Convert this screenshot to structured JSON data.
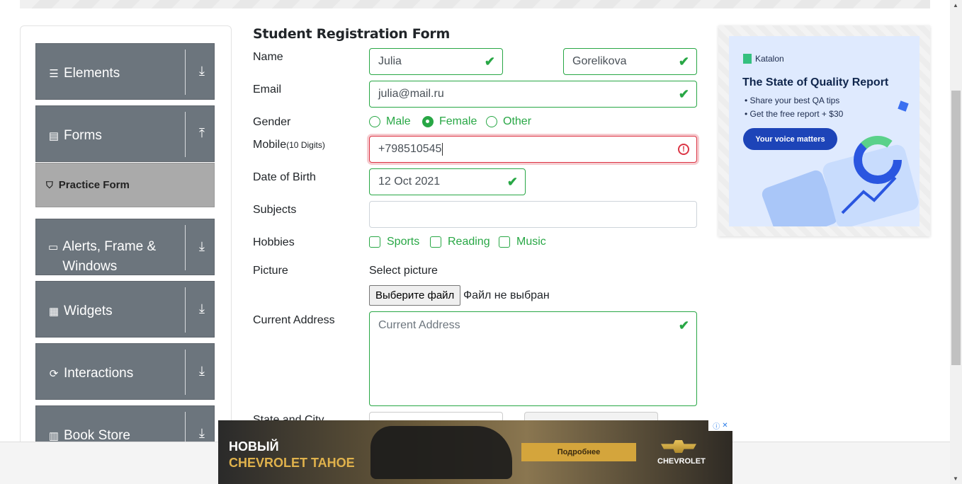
{
  "sidebar": {
    "groups": [
      {
        "label": "Elements",
        "icon": "hamburger-icon",
        "arrow": "⤓"
      },
      {
        "label": "Forms",
        "icon": "document-icon",
        "arrow": "⤒"
      },
      {
        "label": "Alerts, Frame & Windows",
        "icon": "window-icon",
        "arrow": "⤓"
      },
      {
        "label": "Widgets",
        "icon": "widgets-icon",
        "arrow": "⤓"
      },
      {
        "label": "Interactions",
        "icon": "interactions-icon",
        "arrow": "⤓"
      },
      {
        "label": "Book Store",
        "icon": "books-icon",
        "arrow": "⤓"
      }
    ],
    "active_item": "Practice Form"
  },
  "form": {
    "title": "Student Registration Form",
    "name_label": "Name",
    "first_name": "Julia",
    "last_name": "Gorelikova",
    "email_label": "Email",
    "email": "julia@mail.ru",
    "gender_label": "Gender",
    "gender_options": [
      "Male",
      "Female",
      "Other"
    ],
    "gender_selected": "Female",
    "mobile_label": "Mobile",
    "mobile_hint": "(10 Digits)",
    "mobile": "+798510545",
    "dob_label": "Date of Birth",
    "dob": "12 Oct 2021",
    "subjects_label": "Subjects",
    "hobbies_label": "Hobbies",
    "hobbies": [
      "Sports",
      "Reading",
      "Music"
    ],
    "picture_label": "Picture",
    "select_picture": "Select picture",
    "file_button": "Выберите файл",
    "file_status": "Файл не выбран",
    "address_label": "Current Address",
    "address_placeholder": "Current Address",
    "state_label": "State and City"
  },
  "ad_right": {
    "brand": "Katalon",
    "headline": "The State of Quality Report",
    "bullet1": "Share your best QA tips",
    "bullet2": "Get the free report + $30",
    "cta": "Your voice matters"
  },
  "ad_bottom": {
    "line1": "НОВЫЙ",
    "line2": "CHEVROLET TAHOE",
    "button": "Подробнее",
    "brand": "CHEVROLET"
  }
}
